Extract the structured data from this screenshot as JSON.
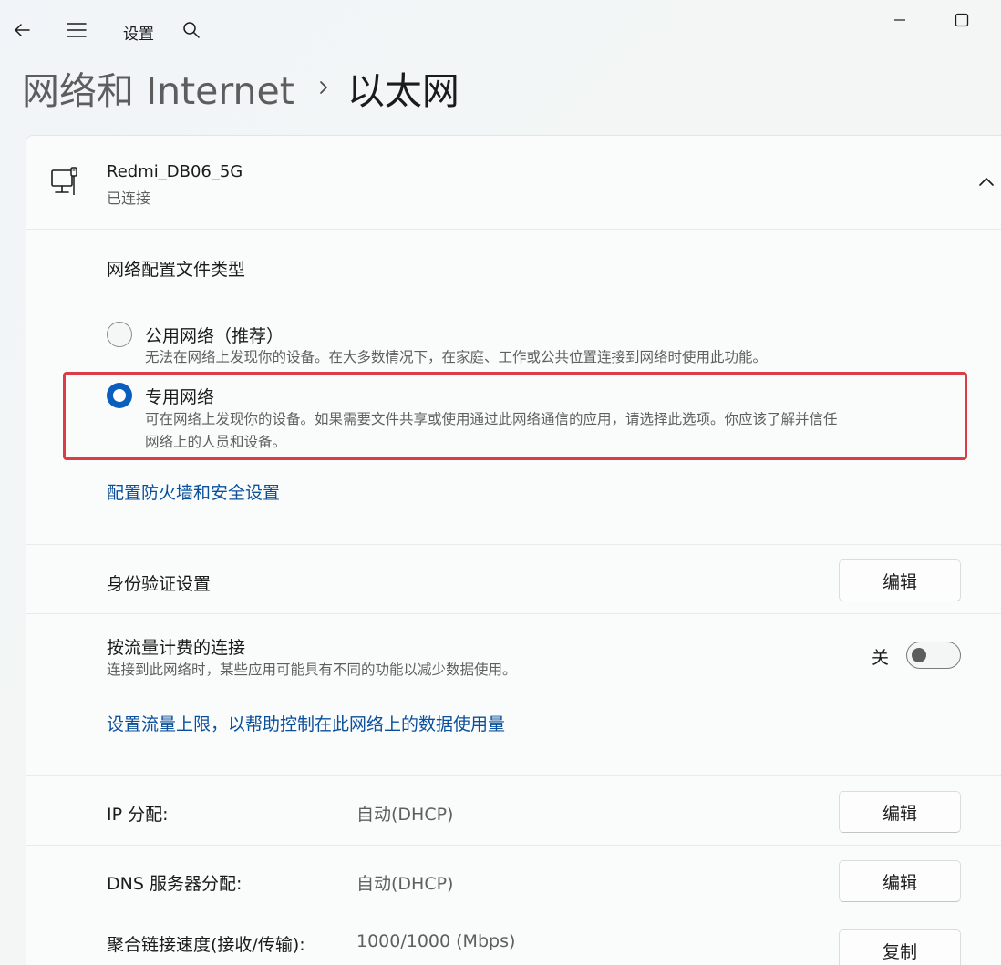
{
  "titlebar": {
    "app_title": "设置",
    "back_icon": "back-arrow-icon",
    "menu_icon": "hamburger-menu-icon",
    "search_icon": "search-icon",
    "minimize_icon": "minimize-icon",
    "maximize_icon": "maximize-icon"
  },
  "breadcrumb": {
    "parent": "网络和 Internet",
    "separator_icon": "chevron-right-icon",
    "current": "以太网"
  },
  "network": {
    "name": "Redmi_DB06_5G",
    "status": "已连接",
    "icon": "ethernet-icon",
    "expanded": true
  },
  "profile": {
    "section_label": "网络配置文件类型",
    "options": [
      {
        "title": "公用网络（推荐）",
        "description": "无法在网络上发现你的设备。在大多数情况下，在家庭、工作或公共位置连接到网络时使用此功能。",
        "selected": false
      },
      {
        "title": "专用网络",
        "description_line1": "可在网络上发现你的设备。如果需要文件共享或使用通过此网络通信的应用，请选择此选项。你应该了解并信任",
        "description_line2": "网络上的人员和设备。",
        "selected": true
      }
    ],
    "highlight_color": "#dc3b48",
    "firewall_link": "配置防火墙和安全设置"
  },
  "auth": {
    "label": "身份验证设置",
    "button": "编辑"
  },
  "metered": {
    "label": "按流量计费的连接",
    "description": "连接到此网络时，某些应用可能具有不同的功能以减少数据使用。",
    "toggle_state_label": "关",
    "toggle_on": false,
    "data_limit_link": "设置流量上限，以帮助控制在此网络上的数据使用量"
  },
  "properties": [
    {
      "label": "IP 分配:",
      "value": "自动(DHCP)",
      "button": "编辑"
    },
    {
      "label": "DNS 服务器分配:",
      "value": "自动(DHCP)",
      "button": "编辑"
    },
    {
      "label": "聚合链接速度(接收/传输):",
      "value": "1000/1000 (Mbps)",
      "button": "复制"
    }
  ],
  "colors": {
    "accent": "#0a5ebd",
    "link": "#0b4f9c"
  }
}
